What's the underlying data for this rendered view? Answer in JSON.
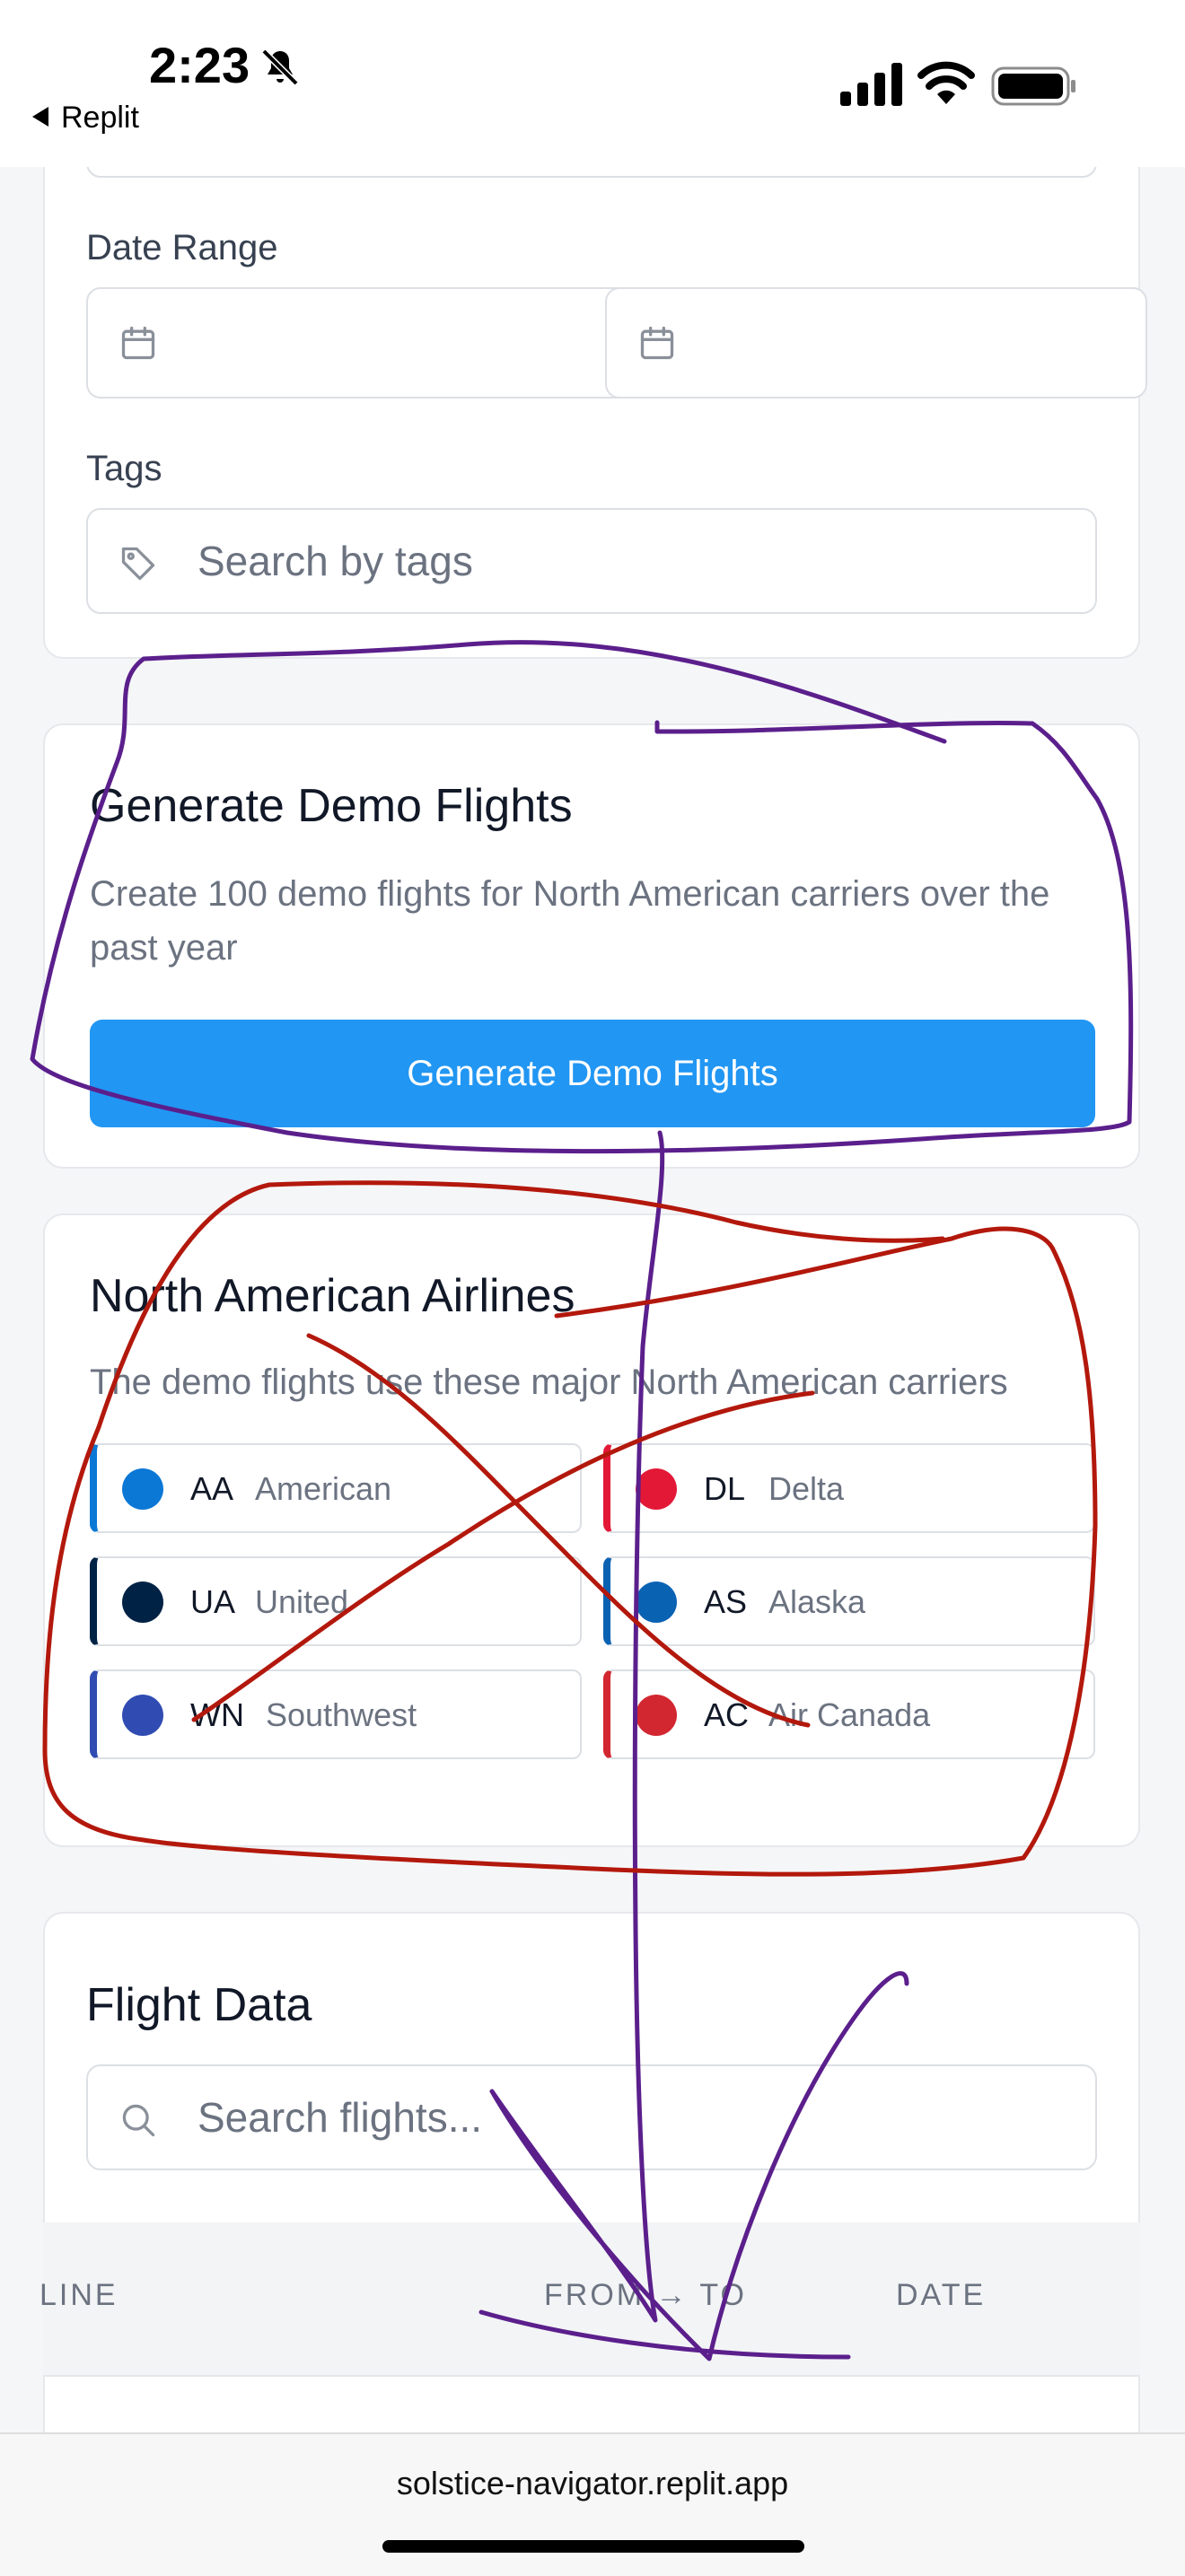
{
  "status_bar": {
    "time": "2:23",
    "back_label": "Replit"
  },
  "filters": {
    "date_range_label": "Date Range",
    "tags_label": "Tags",
    "tags_placeholder": "Search by tags"
  },
  "demo_card": {
    "title": "Generate Demo Flights",
    "description": "Create 100 demo flights for North American carriers over the past year",
    "button_label": "Generate Demo Flights",
    "accent_color": "#2196f3"
  },
  "airlines_card": {
    "title": "North American Airlines",
    "description": "The demo flights use these major North American carriers",
    "airlines": [
      {
        "code": "AA",
        "name": "American",
        "color": "#0b78d6",
        "bar": "#0b78d6"
      },
      {
        "code": "DL",
        "name": "Delta",
        "color": "#e31837",
        "bar": "#e31837"
      },
      {
        "code": "UA",
        "name": "United",
        "color": "#002244",
        "bar": "#002244"
      },
      {
        "code": "AS",
        "name": "Alaska",
        "color": "#0a62b3",
        "bar": "#0a62b3"
      },
      {
        "code": "WN",
        "name": "Southwest",
        "color": "#304cb2",
        "bar": "#304cb2"
      },
      {
        "code": "AC",
        "name": "Air Canada",
        "color": "#d22630",
        "bar": "#d22630"
      }
    ]
  },
  "flight_data": {
    "title": "Flight Data",
    "search_placeholder": "Search flights...",
    "columns": [
      "LINE",
      "FROM → TO",
      "DATE"
    ]
  },
  "browser": {
    "url": "solstice-navigator.replit.app"
  },
  "annotation_colors": {
    "purple": "#5b1f8c",
    "red": "#b3180c"
  }
}
